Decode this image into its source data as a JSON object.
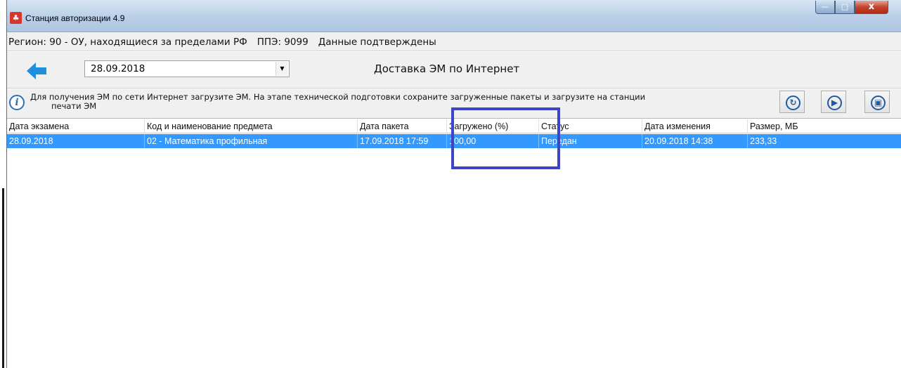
{
  "window": {
    "title": "Станция авторизации 4.9",
    "buttons": {
      "minimize": "—",
      "maximize": "□",
      "close": "x"
    }
  },
  "status": {
    "region": "Регион: 90 - ОУ, находящиеся за пределами РФ",
    "ppe": "ППЭ: 9099",
    "confirmation": "Данные подтверждены"
  },
  "toolbar": {
    "date_value": "28.09.2018",
    "screen_title": "Доставка ЭМ по Интернет"
  },
  "info": {
    "line1": "Для получения ЭМ по сети Интернет загрузите ЭМ. На этапе технической подготовки сохраните загруженные пакеты и загрузите на станции",
    "line2": "печати ЭМ"
  },
  "table": {
    "columns": [
      "Дата экзамена",
      "Код и наименование предмета",
      "Дата пакета",
      "Загружено (%)",
      "Статус",
      "Дата изменения",
      "Размер, МБ"
    ],
    "rows": [
      {
        "exam_date": "28.09.2018",
        "subject": "02 - Математика профильная",
        "package_date": "17.09.2018 17:59",
        "loaded": "100,00",
        "status": "Передан",
        "modified": "20.09.2018 14:38",
        "size": "233,33"
      }
    ]
  },
  "colors": {
    "selection": "#3399ff",
    "highlight_box": "#3f44c4",
    "accent_blue": "#1f5aa6"
  },
  "icons": [
    "app-icon",
    "back-arrow-icon",
    "dropdown-arrow-icon",
    "info-icon",
    "refresh-icon",
    "play-icon",
    "save-icon"
  ]
}
